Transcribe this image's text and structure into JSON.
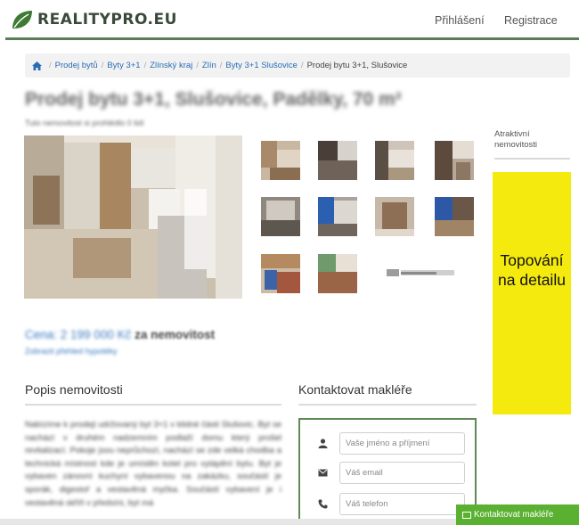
{
  "header": {
    "brand": "REALITYPRO.EU",
    "login": "Přihlášení",
    "register": "Registrace"
  },
  "breadcrumb": {
    "items": [
      "Prodej bytů",
      "Byty 3+1",
      "Zlínský kraj",
      "Zlín",
      "Byty 3+1 Slušovice"
    ],
    "current": "Prodej bytu 3+1, Slušovice"
  },
  "listing": {
    "title": "Prodej bytu 3+1, Slušovice, Padělky, 70 m²",
    "note": "Tuto nemovitost si prohlédlo 0 lidí",
    "price_value": "Cena: 2 199 000 Kč",
    "price_label": "za nemovitost",
    "price_link": "Zobrazit přehled hypotéky"
  },
  "sidebar": {
    "label": "Atraktivní nemovitosti",
    "ad_text": "Topování na detailu"
  },
  "description": {
    "heading": "Popis nemovitosti",
    "text": "Nabízíme k prodeji udržovaný byt 3+1 v klidné části Slušovic. Byt se nachází v druhém nadzemním podlaží domu který prošel revitalizací. Pokoje jsou neprůchozí, nachází se zde velká chodba a technická místnost kde je umístěn kotel pro vytápění bytu. Byt je vybaven zánovní kuchyní vybavenou na zakázku, součástí je sporák, digestoř a vestavěná myčka. Součástí vybavení je i vestavěná skříň v předsíni, byt má"
  },
  "contact": {
    "heading": "Kontaktovat makléře",
    "name_placeholder": "Vaše jméno a příjmení",
    "email_placeholder": "Váš email",
    "phone_placeholder": "Váš telefon",
    "button": "Kontaktovat makléře"
  },
  "colors": {
    "brand_green": "#5a7c56",
    "ad_yellow": "#f5ea0d",
    "button_green": "#5ab031",
    "link_blue": "#2a6db5"
  }
}
